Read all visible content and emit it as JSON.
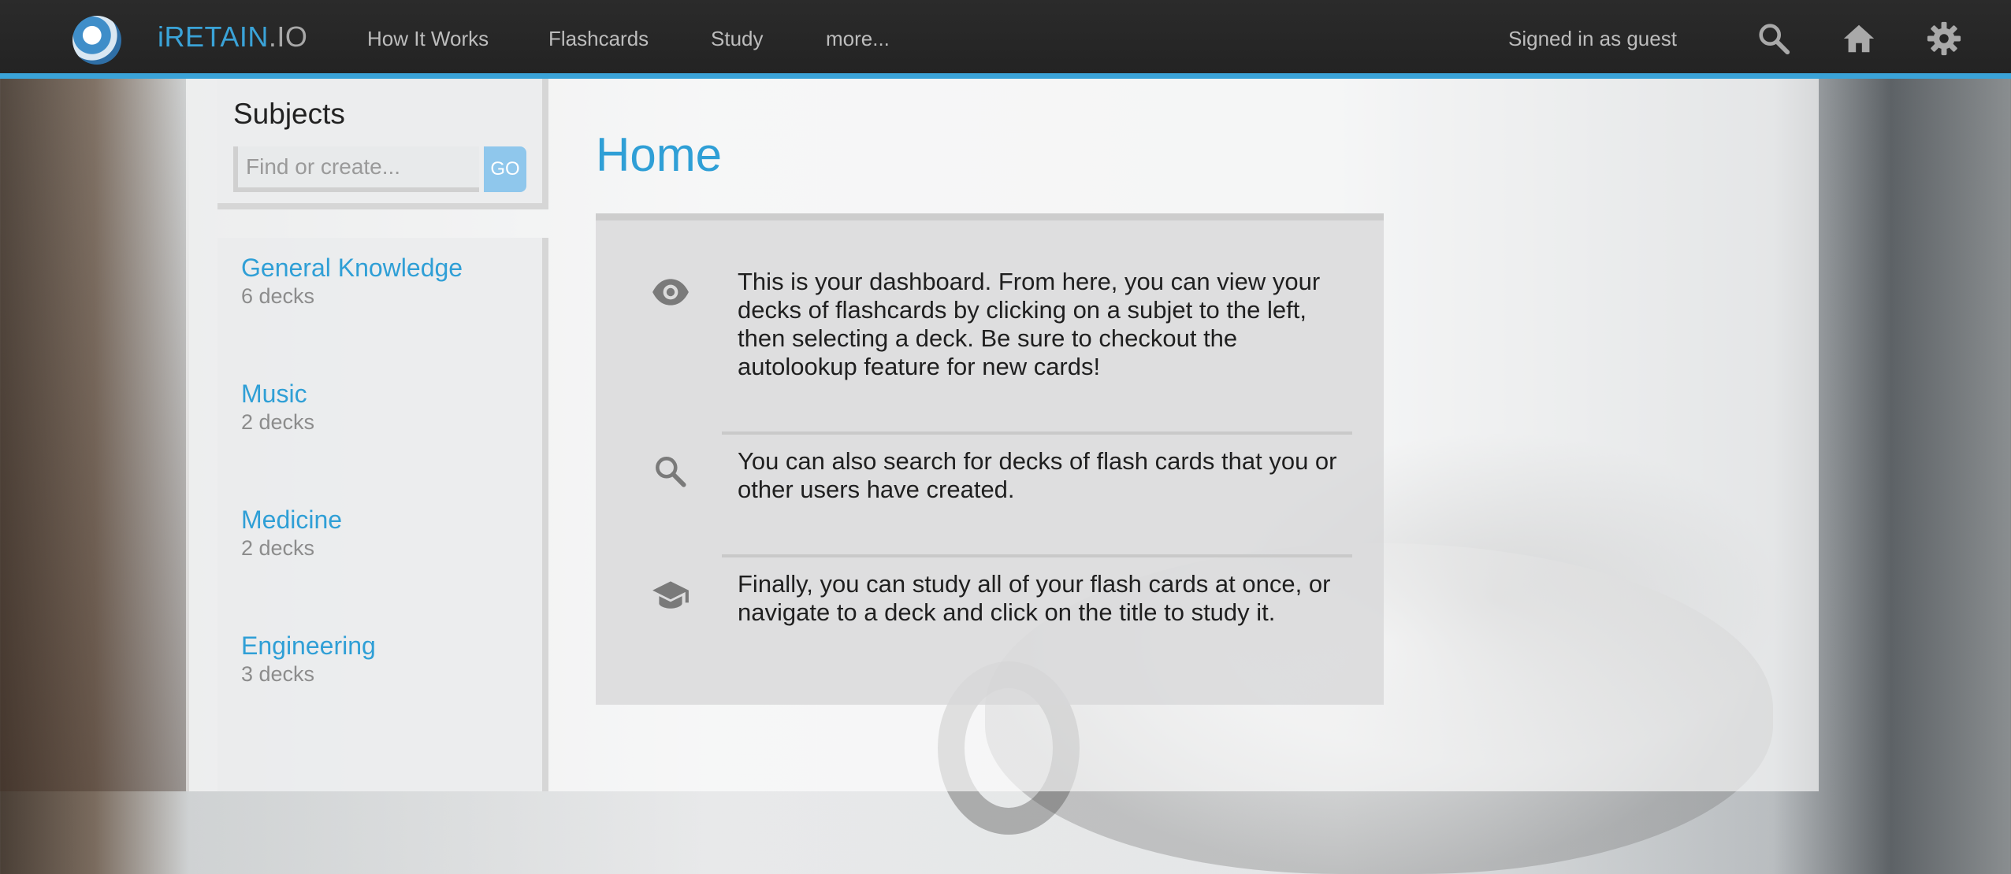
{
  "brand": {
    "name": "iRETAIN",
    "suffix": ".IO"
  },
  "nav": {
    "items": [
      "How It Works",
      "Flashcards",
      "Study",
      "more..."
    ]
  },
  "header": {
    "signed_in_text": "Signed in as guest",
    "icons": [
      "search-icon",
      "home-icon",
      "gear-icon"
    ]
  },
  "colors": {
    "accent": "#3aa3d8",
    "topbar": "#262626",
    "go_button": "#8fc7ec"
  },
  "sidebar": {
    "title": "Subjects",
    "search_placeholder": "Find or create...",
    "go_label": "GO",
    "subjects": [
      {
        "name": "General Knowledge",
        "count": "6 decks"
      },
      {
        "name": "Music",
        "count": "2 decks"
      },
      {
        "name": "Medicine",
        "count": "2 decks"
      },
      {
        "name": "Engineering",
        "count": "3 decks"
      }
    ]
  },
  "main": {
    "title": "Home",
    "info": [
      {
        "icon": "eye-icon",
        "text": "This is your dashboard. From here, you can view your decks of flashcards by clicking on a subjet to the left, then selecting a deck. Be sure to checkout the autolookup feature for new cards!"
      },
      {
        "icon": "search-icon",
        "text": "You can also search for decks of flash cards that you or other users have created."
      },
      {
        "icon": "graduation-cap-icon",
        "text": "Finally, you can study all of your flash cards at once, or navigate to a deck and click on the title to study it."
      }
    ]
  }
}
